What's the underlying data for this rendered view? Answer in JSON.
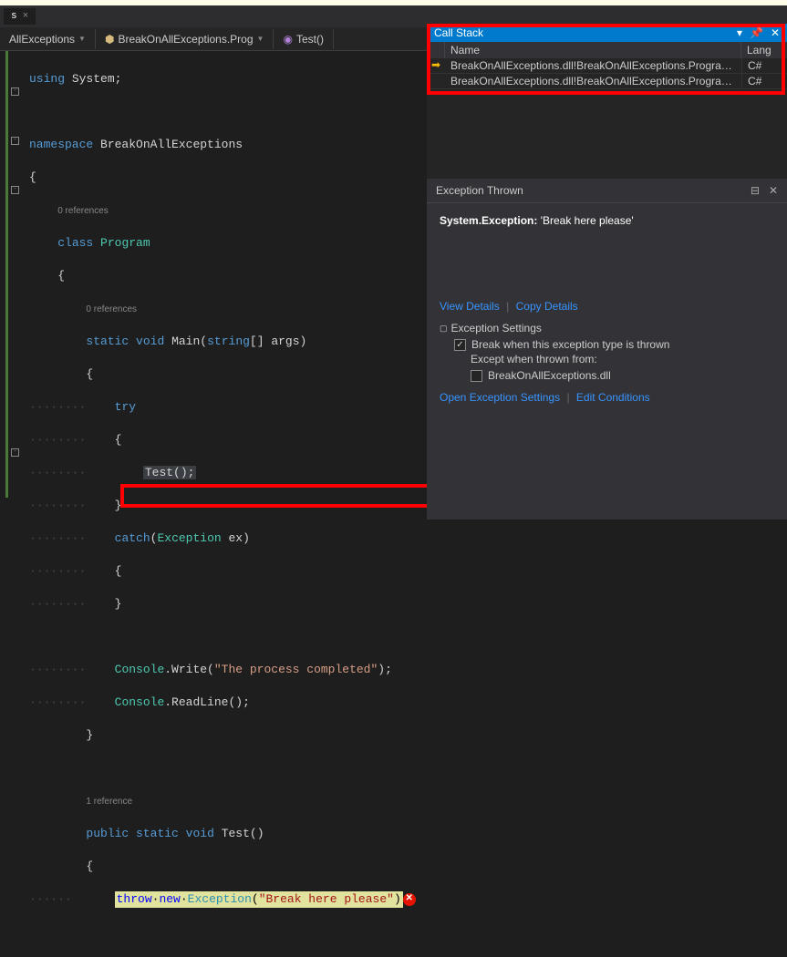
{
  "tab": {
    "label": "s"
  },
  "breadcrumbs": {
    "project": "AllExceptions",
    "class": "BreakOnAllExceptions.Prog",
    "method": "Test()"
  },
  "code": {
    "using": "using",
    "system": "System",
    "namespace": "namespace",
    "ns_name": "BreakOnAllExceptions",
    "refs0": "0 references",
    "refs1": "1 reference",
    "class_kw": "class",
    "class_name": "Program",
    "static": "static",
    "void": "void",
    "main": "Main",
    "string_arr": "string",
    "args": "[] args)",
    "try": "try",
    "test_call": "Test();",
    "catch": "catch",
    "exception_type": "Exception",
    "ex": " ex)",
    "console": "Console",
    "write": ".Write(",
    "write_str": "\"The process completed\"",
    "writeln": ");",
    "readline": ".ReadLine();",
    "public": "public",
    "test": "Test()",
    "throw": "throw",
    "new": "new",
    "exc_ctor": "Exception",
    "exc_str": "\"Break here please\""
  },
  "callstack": {
    "title": "Call Stack",
    "col_name": "Name",
    "col_lang": "Lang",
    "rows": [
      {
        "arrow": "➡",
        "name": "BreakOnAllExceptions.dll!BreakOnAllExceptions.Progra…",
        "lang": "C#"
      },
      {
        "arrow": "",
        "name": "BreakOnAllExceptions.dll!BreakOnAllExceptions.Progra…",
        "lang": "C#"
      }
    ]
  },
  "exception": {
    "title": "Exception Thrown",
    "message_type": "System.Exception:",
    "message_text": " 'Break here please'",
    "view_details": "View Details",
    "copy_details": "Copy Details",
    "settings_label": "Exception Settings",
    "break_when": "Break when this exception type is thrown",
    "except_from": "Except when thrown from:",
    "lib": "BreakOnAllExceptions.dll",
    "open_settings": "Open Exception Settings",
    "edit_conditions": "Edit Conditions"
  }
}
